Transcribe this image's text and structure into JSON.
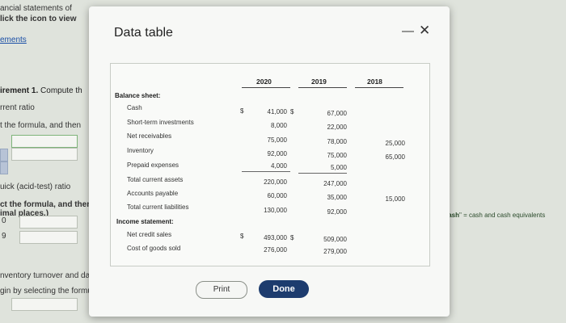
{
  "background": {
    "top_line_1": "ancial statements of",
    "top_line_2": "lick the icon to view",
    "link": "ements",
    "requirement_title": "irement 1.",
    "requirement_text": "Compute th",
    "current_ratio_label": "rrent ratio",
    "formula_line": "t the formula, and then",
    "quick_ratio_label": "uick (acid-test) ratio",
    "formula_line_2": "ct the formula, and then",
    "decimal_line": "imal places.)",
    "stepper_1": "0",
    "stepper_2": "9",
    "inventory_line": "nventory turnover and da",
    "selecting_line": "gin by selecting the formu",
    "right_note_bold": "and Cash",
    "right_note_rest": "= cash and cash equivalents"
  },
  "modal": {
    "title": "Data table",
    "minimize_icon": "minimize-icon",
    "close_icon": "close-icon",
    "table": {
      "columns": [
        "2020",
        "2019",
        "2018"
      ],
      "sections": {
        "balance_sheet": "Balance sheet:",
        "income_statement": "Income statement:"
      },
      "rows": [
        {
          "label": "Cash",
          "v2020": "41,000",
          "v2019": "67,000",
          "v2018": "",
          "dollar_2020": "$",
          "dollar_2019": "$"
        },
        {
          "label": "Short-term investments",
          "v2020": "8,000",
          "v2019": "22,000",
          "v2018": ""
        },
        {
          "label": "Net receivables",
          "v2020": "75,000",
          "v2019": "78,000",
          "v2018": "25,000"
        },
        {
          "label": "Inventory",
          "v2020": "92,000",
          "v2019": "75,000",
          "v2018": "65,000"
        },
        {
          "label": "Prepaid expenses",
          "v2020": "4,000",
          "v2019": "5,000",
          "v2018": ""
        },
        {
          "label": "Total current assets",
          "v2020": "220,000",
          "v2019": "247,000",
          "v2018": ""
        },
        {
          "label": "Accounts payable",
          "v2020": "60,000",
          "v2019": "35,000",
          "v2018": "15,000"
        },
        {
          "label": "Total current liabilities",
          "v2020": "130,000",
          "v2019": "92,000",
          "v2018": ""
        },
        {
          "label": "Net credit sales",
          "v2020": "493,000",
          "v2019": "509,000",
          "v2018": "",
          "dollar_2020": "$",
          "dollar_2019": "$"
        },
        {
          "label": "Cost of goods sold",
          "v2020": "276,000",
          "v2019": "279,000",
          "v2018": ""
        }
      ]
    },
    "buttons": {
      "print": "Print",
      "done": "Done"
    }
  }
}
